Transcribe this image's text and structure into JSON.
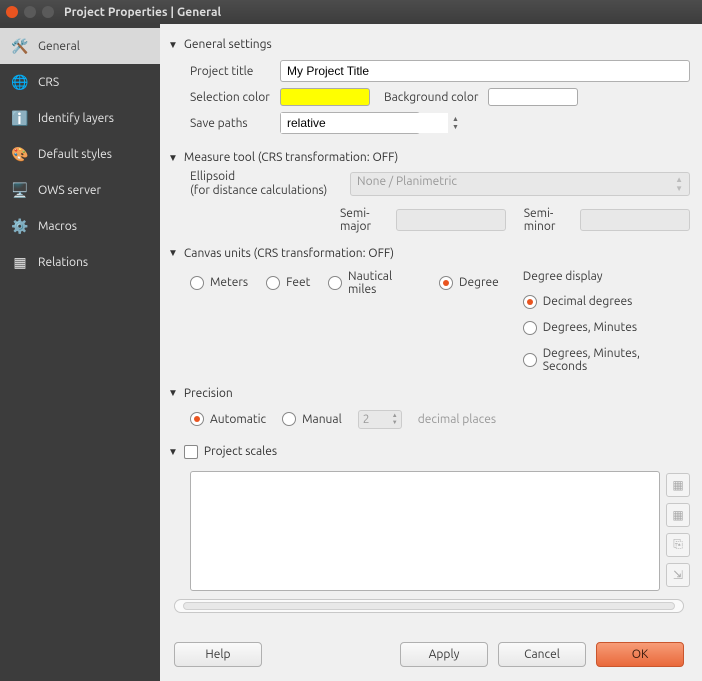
{
  "window": {
    "title": "Project Properties | General"
  },
  "sidebar": {
    "items": [
      {
        "label": "General"
      },
      {
        "label": "CRS"
      },
      {
        "label": "Identify layers"
      },
      {
        "label": "Default styles"
      },
      {
        "label": "OWS server"
      },
      {
        "label": "Macros"
      },
      {
        "label": "Relations"
      }
    ]
  },
  "general": {
    "section_title": "General settings",
    "project_title_label": "Project title",
    "project_title_value": "My Project Title",
    "selection_color_label": "Selection color",
    "background_color_label": "Background color",
    "save_paths_label": "Save paths",
    "save_paths_value": "relative"
  },
  "measure": {
    "section_title": "Measure tool (CRS transformation: OFF)",
    "ellipsoid_label": "Ellipsoid\n(for distance calculations)",
    "ellipsoid_label_line1": "Ellipsoid",
    "ellipsoid_label_line2": "(for distance calculations)",
    "ellipsoid_value": "None / Planimetric",
    "semi_major_label": "Semi-major",
    "semi_minor_label": "Semi-minor"
  },
  "canvas": {
    "section_title": "Canvas units (CRS transformation: OFF)",
    "options": {
      "meters": "Meters",
      "feet": "Feet",
      "nautical": "Nautical miles",
      "degree": "Degree"
    },
    "degree_display_label": "Degree display",
    "degree_options": {
      "decimal": "Decimal degrees",
      "dm": "Degrees, Minutes",
      "dms": "Degrees, Minutes, Seconds"
    }
  },
  "precision": {
    "section_title": "Precision",
    "automatic": "Automatic",
    "manual": "Manual",
    "spin_value": "2",
    "decimal_places": "decimal places"
  },
  "scales": {
    "section_title": "Project scales"
  },
  "buttons": {
    "help": "Help",
    "apply": "Apply",
    "cancel": "Cancel",
    "ok": "OK"
  }
}
